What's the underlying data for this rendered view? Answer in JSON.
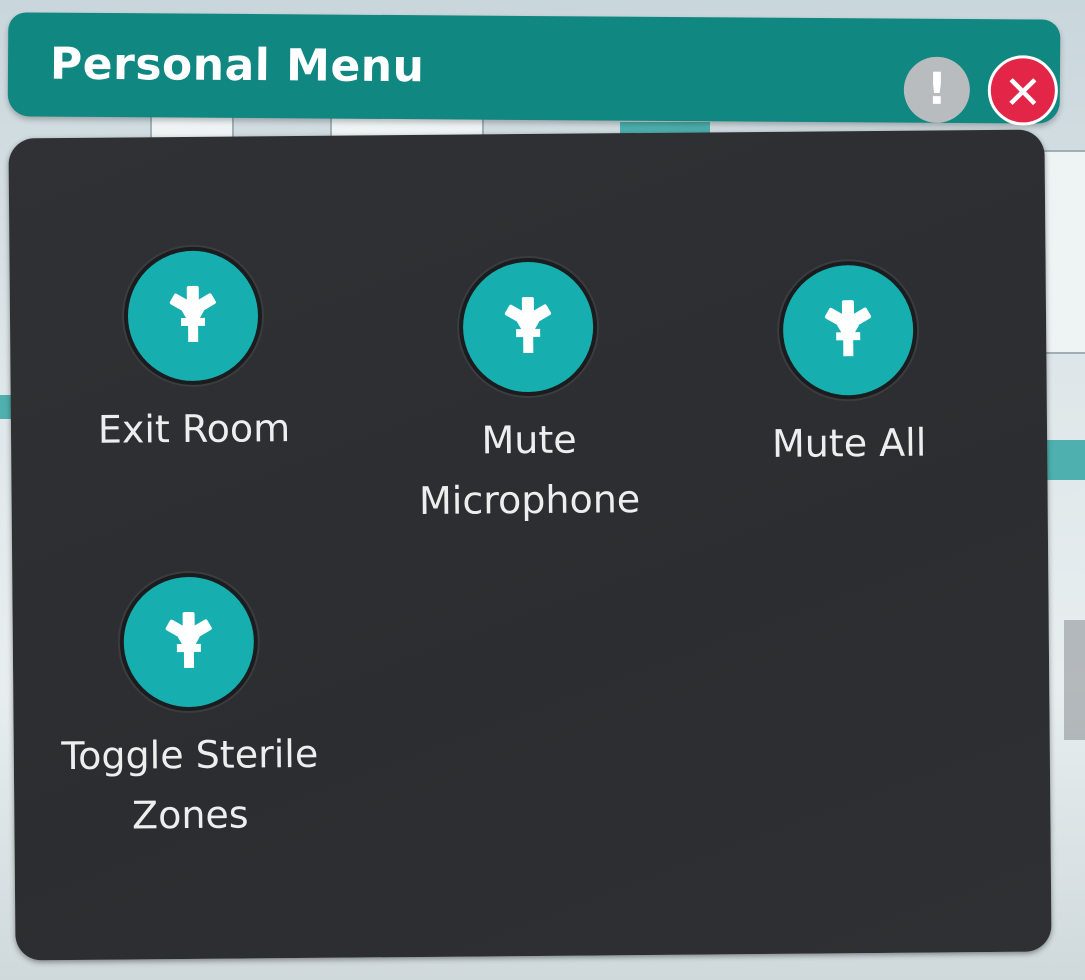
{
  "header": {
    "title": "Personal Menu",
    "info_label": "!",
    "close_label": "✕"
  },
  "colors": {
    "header_bg": "#118781",
    "panel_bg": "#2e3033",
    "button_teal": "#17aeb0",
    "close_red": "#e32647",
    "info_gray": "#b9bcbf"
  },
  "menu": {
    "items": [
      {
        "label": "Exit Room",
        "icon": "asterisk-icon"
      },
      {
        "label": "Mute\nMicrophone",
        "icon": "asterisk-icon"
      },
      {
        "label": "Mute All",
        "icon": "asterisk-icon"
      },
      {
        "label": "Toggle Sterile\nZones",
        "icon": "asterisk-icon"
      }
    ]
  }
}
